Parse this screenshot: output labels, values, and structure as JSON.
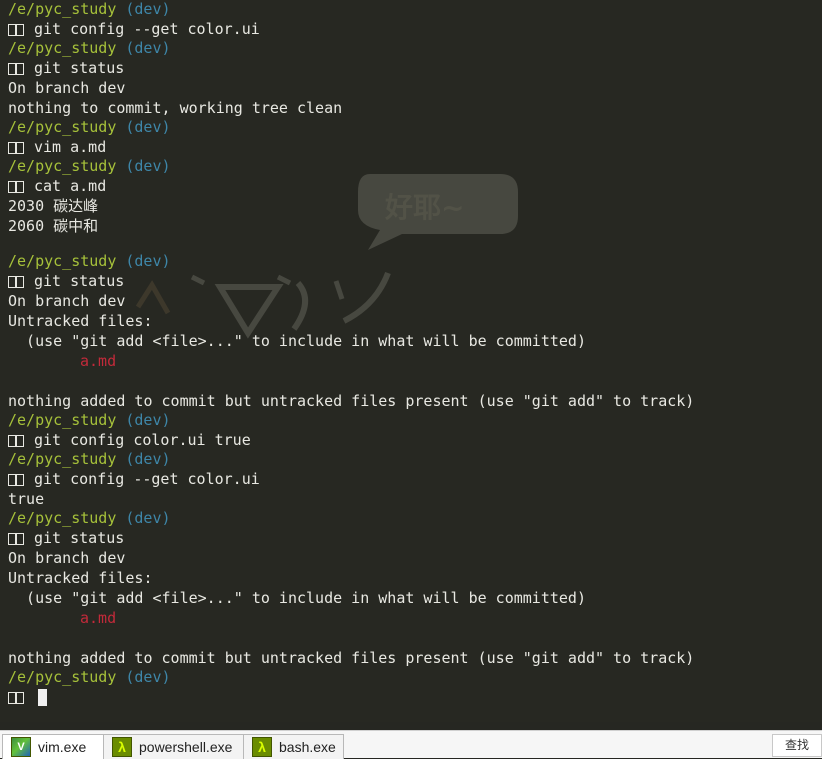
{
  "terminal": {
    "path": "/e/pyc_study",
    "branch": "(dev)",
    "commands": {
      "c1": "git config --get color.ui",
      "c2": "git status",
      "c3": "vim a.md",
      "c4": "cat a.md",
      "c5": "git status",
      "c6": "git config color.ui true",
      "c7": "git config --get color.ui",
      "c8": "git status"
    },
    "output": {
      "o1": "On branch dev",
      "o2": "nothing to commit, working tree clean",
      "o3": "2030 碳达峰",
      "o4": "2060 碳中和",
      "o5": "On branch dev",
      "o6": "Untracked files:",
      "o7": "  (use \"git add <file>...\" to include in what will be committed)",
      "o8": "a.md",
      "o9": "nothing added to commit but untracked files present (use \"git add\" to track)",
      "o10": "true",
      "o11": "On branch dev",
      "o12": "Untracked files:",
      "o13": "  (use \"git add <file>...\" to include in what will be committed)",
      "o14": "a.md",
      "o15": "nothing added to commit but untracked files present (use \"git add\" to track)"
    },
    "watermark_text": "好耶~"
  },
  "taskbar": {
    "tabs": [
      {
        "label": "vim.exe",
        "icon": "vim-icon"
      },
      {
        "label": "powershell.exe",
        "icon": "lambda-icon"
      },
      {
        "label": "bash.exe",
        "icon": "lambda-icon"
      }
    ],
    "lambda_glyph": "λ",
    "search_label": "查找"
  },
  "colors": {
    "background": "#272822",
    "path": "#a6c13a",
    "branch": "#3e86a8",
    "untracked": "#c22a3a"
  }
}
